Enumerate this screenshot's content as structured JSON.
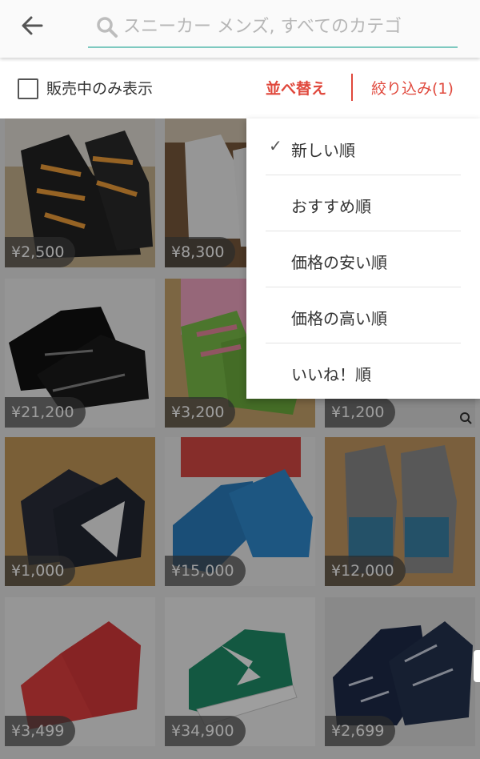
{
  "search": {
    "placeholder": "スニーカー メンズ, すべてのカテゴ",
    "value": ""
  },
  "filter_bar": {
    "onsale_label": "販売中のみ表示",
    "onsale_checked": false,
    "sort_label": "並べ替え",
    "filter_label": "絞り込み(1)"
  },
  "sort_menu": {
    "options": [
      {
        "label": "新しい順",
        "selected": true
      },
      {
        "label": "おすすめ順",
        "selected": false
      },
      {
        "label": "価格の安い順",
        "selected": false
      },
      {
        "label": "価格の高い順",
        "selected": false
      },
      {
        "label": "いいね！順",
        "selected": false
      }
    ],
    "check_mark": "✓"
  },
  "items": [
    {
      "price": "¥2,500",
      "desc": "black high-top sneakers with orange laces"
    },
    {
      "price": "¥8,300",
      "desc": "white sneakers"
    },
    {
      "price": "",
      "desc": "hidden by menu"
    },
    {
      "price": "¥21,200",
      "desc": "black sneakers"
    },
    {
      "price": "¥3,200",
      "desc": "green and pink sneakers"
    },
    {
      "price": "¥1,200",
      "desc": "partially hidden"
    },
    {
      "price": "¥1,000",
      "desc": "navy high-top sneakers"
    },
    {
      "price": "¥15,000",
      "desc": "blue sneakers"
    },
    {
      "price": "¥12,000",
      "desc": "grey new balance sneakers"
    },
    {
      "price": "¥3,499",
      "desc": "red sneakers"
    },
    {
      "price": "¥34,900",
      "desc": "green white star sneakers"
    },
    {
      "price": "¥2,699",
      "desc": "black patterned knit sneakers"
    }
  ],
  "colors": {
    "accent": "#e0483c",
    "search_underline": "#7ec9c0"
  }
}
